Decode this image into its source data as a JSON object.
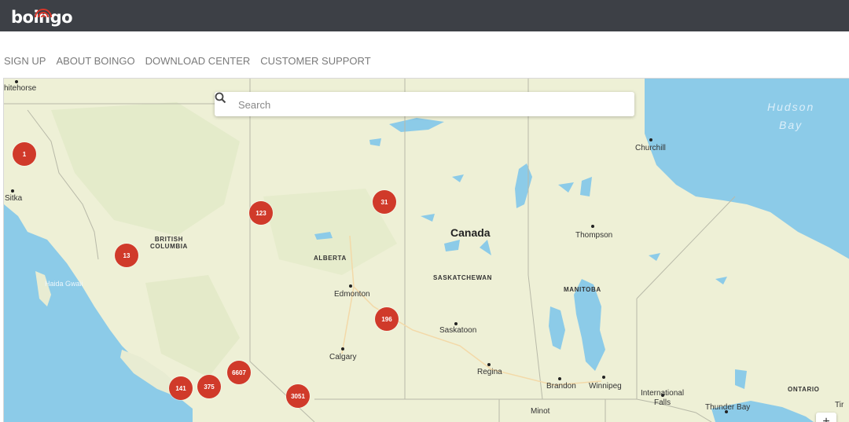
{
  "app": {
    "logo_text": "boingo",
    "logo_icon": "wifi-signal-icon"
  },
  "nav": {
    "items": [
      "SIGN UP",
      "ABOUT BOINGO",
      "DOWNLOAD CENTER",
      "CUSTOMER SUPPORT"
    ]
  },
  "search": {
    "placeholder": "Search",
    "value": "",
    "icon": "search-icon"
  },
  "map": {
    "country_label": "Canada",
    "water_labels": [
      "Hudson",
      "Bay",
      "Haida Gwaii"
    ],
    "provinces": [
      {
        "line1": "BRITISH",
        "line2": "COLUMBIA"
      },
      {
        "line1": "ALBERTA",
        "line2": ""
      },
      {
        "line1": "SASKATCHEWAN",
        "line2": ""
      },
      {
        "line1": "MANITOBA",
        "line2": ""
      },
      {
        "line1": "ONTARIO",
        "line2": ""
      }
    ],
    "places": [
      "hitehorse",
      "Sitka",
      "Churchill",
      "Thompson",
      "Edmonton",
      "Saskatoon",
      "Calgary",
      "Regina",
      "Brandon",
      "Winnipeg",
      "International",
      "Falls",
      "Thunder Bay",
      "Minot",
      "Tir"
    ],
    "clusters": [
      "1",
      "123",
      "31",
      "13",
      "196",
      "6607",
      "375",
      "141",
      "3051"
    ],
    "zoom_in_label": "+"
  },
  "colors": {
    "topbar": "#3d4046",
    "cluster": "#d03a2a",
    "water": "#8ccbe8",
    "land": "#eef0d6",
    "nav_text": "#7a7a7a"
  }
}
